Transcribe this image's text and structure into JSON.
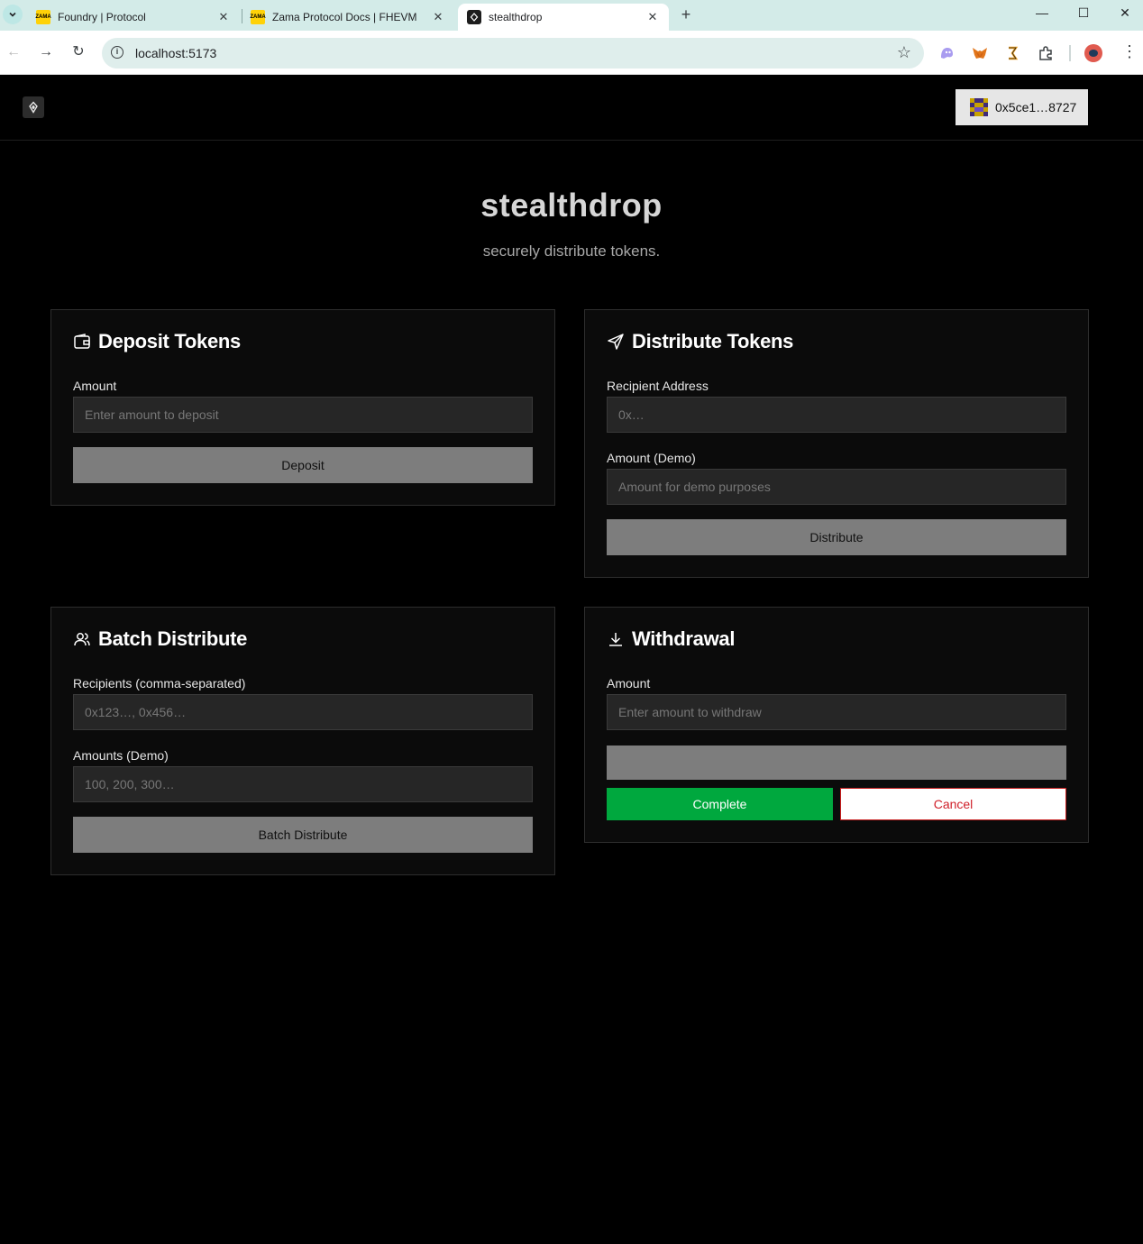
{
  "browser": {
    "tabs": [
      {
        "title": "Foundry | Protocol",
        "favicon_text": "ZAMA"
      },
      {
        "title": "Zama Protocol Docs | FHEVM",
        "favicon_text": "ZAMA"
      },
      {
        "title": "stealthdrop",
        "favicon_text": ""
      }
    ],
    "url": "localhost:5173"
  },
  "header": {
    "wallet_label": "0x5ce1…8727"
  },
  "hero": {
    "title": "stealthdrop",
    "subtitle": "securely distribute tokens."
  },
  "deposit": {
    "title": "Deposit Tokens",
    "amount_label": "Amount",
    "amount_placeholder": "Enter amount to deposit",
    "button": "Deposit"
  },
  "distribute": {
    "title": "Distribute Tokens",
    "recipient_label": "Recipient Address",
    "recipient_placeholder": "0x…",
    "amount_label": "Amount (Demo)",
    "amount_placeholder": "Amount for demo purposes",
    "button": "Distribute"
  },
  "batch": {
    "title": "Batch Distribute",
    "recipients_label": "Recipients (comma-separated)",
    "recipients_placeholder": "0x123…, 0x456…",
    "amounts_label": "Amounts (Demo)",
    "amounts_placeholder": "100, 200, 300…",
    "button": "Batch Distribute"
  },
  "withdrawal": {
    "title": "Withdrawal",
    "amount_label": "Amount",
    "amount_placeholder": "Enter amount to withdraw",
    "complete_button": "Complete",
    "cancel_button": "Cancel"
  },
  "colors": {
    "background": "#000000",
    "card": "#0b0b0b",
    "button_gray": "#7d7d7d",
    "complete_green": "#00a83e",
    "cancel_red": "#c81e1e"
  }
}
